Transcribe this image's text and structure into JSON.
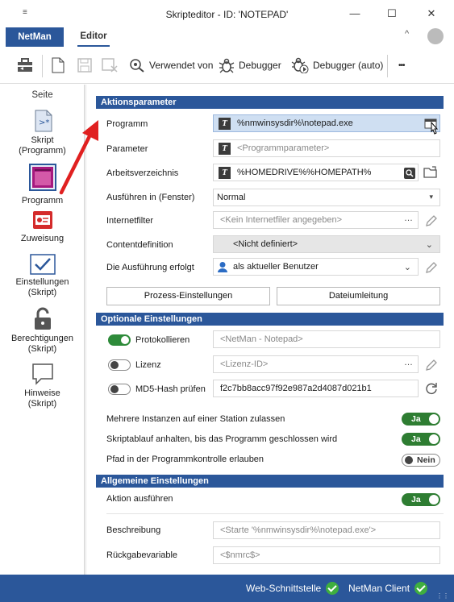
{
  "window": {
    "title": "Skripteditor - ID: 'NOTEPAD'",
    "minimize": "—",
    "maximize": "☐",
    "close": "✕"
  },
  "ribbon": {
    "tab_netman": "NetMan",
    "tab_editor": "Editor"
  },
  "toolbar": {
    "used_by": "Verwendet von",
    "debugger": "Debugger",
    "debugger_auto": "Debugger (auto)",
    "more": "•••"
  },
  "nav": {
    "heading": "Seite",
    "items": [
      {
        "label": "Skript\n(Programm)"
      },
      {
        "label": "Programm"
      },
      {
        "label": "Zuweisung"
      },
      {
        "label": "Einstellungen\n(Skript)"
      },
      {
        "label": "Berechtigungen\n(Skript)"
      },
      {
        "label": "Hinweise\n(Skript)"
      }
    ]
  },
  "action_params": {
    "header": "Aktionsparameter",
    "program_label": "Programm",
    "program_value": "%nmwinsysdir%\\notepad.exe",
    "parameter_label": "Parameter",
    "parameter_placeholder": "<Programmparameter>",
    "workdir_label": "Arbeitsverzeichnis",
    "workdir_value": "%HOMEDRIVE%%HOMEPATH%",
    "run_in_label": "Ausführen in (Fenster)",
    "run_in_value": "Normal",
    "internet_filter_label": "Internetfilter",
    "internet_filter_placeholder": "<Kein Internetfiler angegeben>",
    "content_def_label": "Contentdefinition",
    "content_def_value": "<Nicht definiert>",
    "run_as_label": "Die Ausführung erfolgt",
    "run_as_value": "als aktueller Benutzer",
    "btn_process": "Prozess-Einstellungen",
    "btn_redirect": "Dateiumleitung"
  },
  "optional": {
    "header": "Optionale Einstellungen",
    "logging_label": "Protokollieren",
    "logging_placeholder": "<NetMan - Notepad>",
    "logging_on": true,
    "license_label": "Lizenz",
    "license_placeholder": "<Lizenz-ID>",
    "license_on": false,
    "md5_label": "MD5-Hash prüfen",
    "md5_value": "f2c7bb8acc97f92e987a2d4087d021b1",
    "md5_on": false,
    "multi_instance_label": "Mehrere Instanzen auf einer Station zulassen",
    "multi_instance_value": "Ja",
    "pause_label": "Skriptablauf anhalten, bis das Programm geschlossen wird",
    "pause_value": "Ja",
    "path_control_label": "Pfad in der Programmkontrolle erlauben",
    "path_control_value": "Nein"
  },
  "general": {
    "header": "Allgemeine Einstellungen",
    "execute_label": "Aktion ausführen",
    "execute_value": "Ja",
    "description_label": "Beschreibung",
    "description_placeholder": "<Starte '%nmwinsysdir%\\notepad.exe'>",
    "return_label": "Rückgabevariable",
    "return_placeholder": "<$nmrc$>"
  },
  "status": {
    "web_interface": "Web-Schnittstelle",
    "netman_client": "NetMan Client"
  },
  "colors": {
    "accent": "#2b579a",
    "toggle_on": "#2e7d32",
    "status_ok": "#3fae3f",
    "arrow": "#e02020"
  }
}
